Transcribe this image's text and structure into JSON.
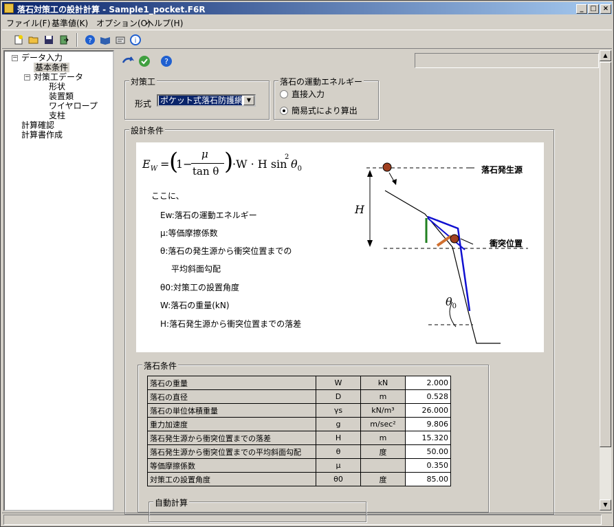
{
  "window": {
    "title": "落石対策工の設計計算 - Sample1_pocket.F6R"
  },
  "menu": [
    "ファイル(F)",
    "基準値(K)",
    "オプション(O)",
    "ヘルプ(H)"
  ],
  "tree": {
    "root": "データ入力",
    "basic": "基本条件",
    "measure": "対策工データ",
    "shape": "形状",
    "device": "装置類",
    "wire": "ワイヤロープ",
    "post": "支柱",
    "check": "計算確認",
    "report": "計算書作成"
  },
  "measure_group": {
    "label": "対策工",
    "type_label": "形式",
    "type_value": "ポケット式落石防護網"
  },
  "energy_group": {
    "label": "落石の運動エネルギー",
    "opt_direct": "直接入力",
    "opt_simple": "簡易式により算出",
    "selected": "simple"
  },
  "design_group": {
    "label": "設計条件"
  },
  "figure": {
    "formula_lhs": "E",
    "formula_lhs_sub": "W",
    "formula_mu": "μ",
    "formula_den": "tan θ",
    "formula_tail": "·W · H sin",
    "formula_sq": "2",
    "formula_theta0": "θ",
    "formula_theta0_sub": "0",
    "intro": "ここに、",
    "lines": [
      "Ew:落石の運動エネルギー",
      "μ:等価摩擦係数",
      "θ:落石の発生源から衝突位置までの",
      "平均斜面勾配",
      "θ0:対策工の設置角度",
      "W:落石の重量(kN)",
      "H:落石発生源から衝突位置までの落差"
    ],
    "label_source": "落石発生源",
    "label_impact": "衝突位置",
    "label_H": "H",
    "label_theta0": "θ",
    "label_theta0_sub": "0"
  },
  "rock_group": {
    "label": "落石条件"
  },
  "table": [
    {
      "name": "落石の重量",
      "sym": "W",
      "unit": "kN",
      "value": "2.000"
    },
    {
      "name": "落石の直径",
      "sym": "D",
      "unit": "m",
      "value": "0.528"
    },
    {
      "name": "落石の単位体積重量",
      "sym": "γs",
      "unit": "kN/m³",
      "value": "26.000"
    },
    {
      "name": "重力加速度",
      "sym": "g",
      "unit": "m/sec²",
      "value": "9.806"
    },
    {
      "name": "落石発生源から衝突位置までの落差",
      "sym": "H",
      "unit": "m",
      "value": "15.320"
    },
    {
      "name": "落石発生源から衝突位置までの平均斜面勾配",
      "sym": "θ",
      "unit": "度",
      "value": "50.00"
    },
    {
      "name": "等価摩擦係数",
      "sym": "μ",
      "unit": "",
      "value": "0.350"
    },
    {
      "name": "対策工の設置角度",
      "sym": "θ0",
      "unit": "度",
      "value": "85.00"
    }
  ],
  "auto_group": {
    "label": "自動計算"
  }
}
